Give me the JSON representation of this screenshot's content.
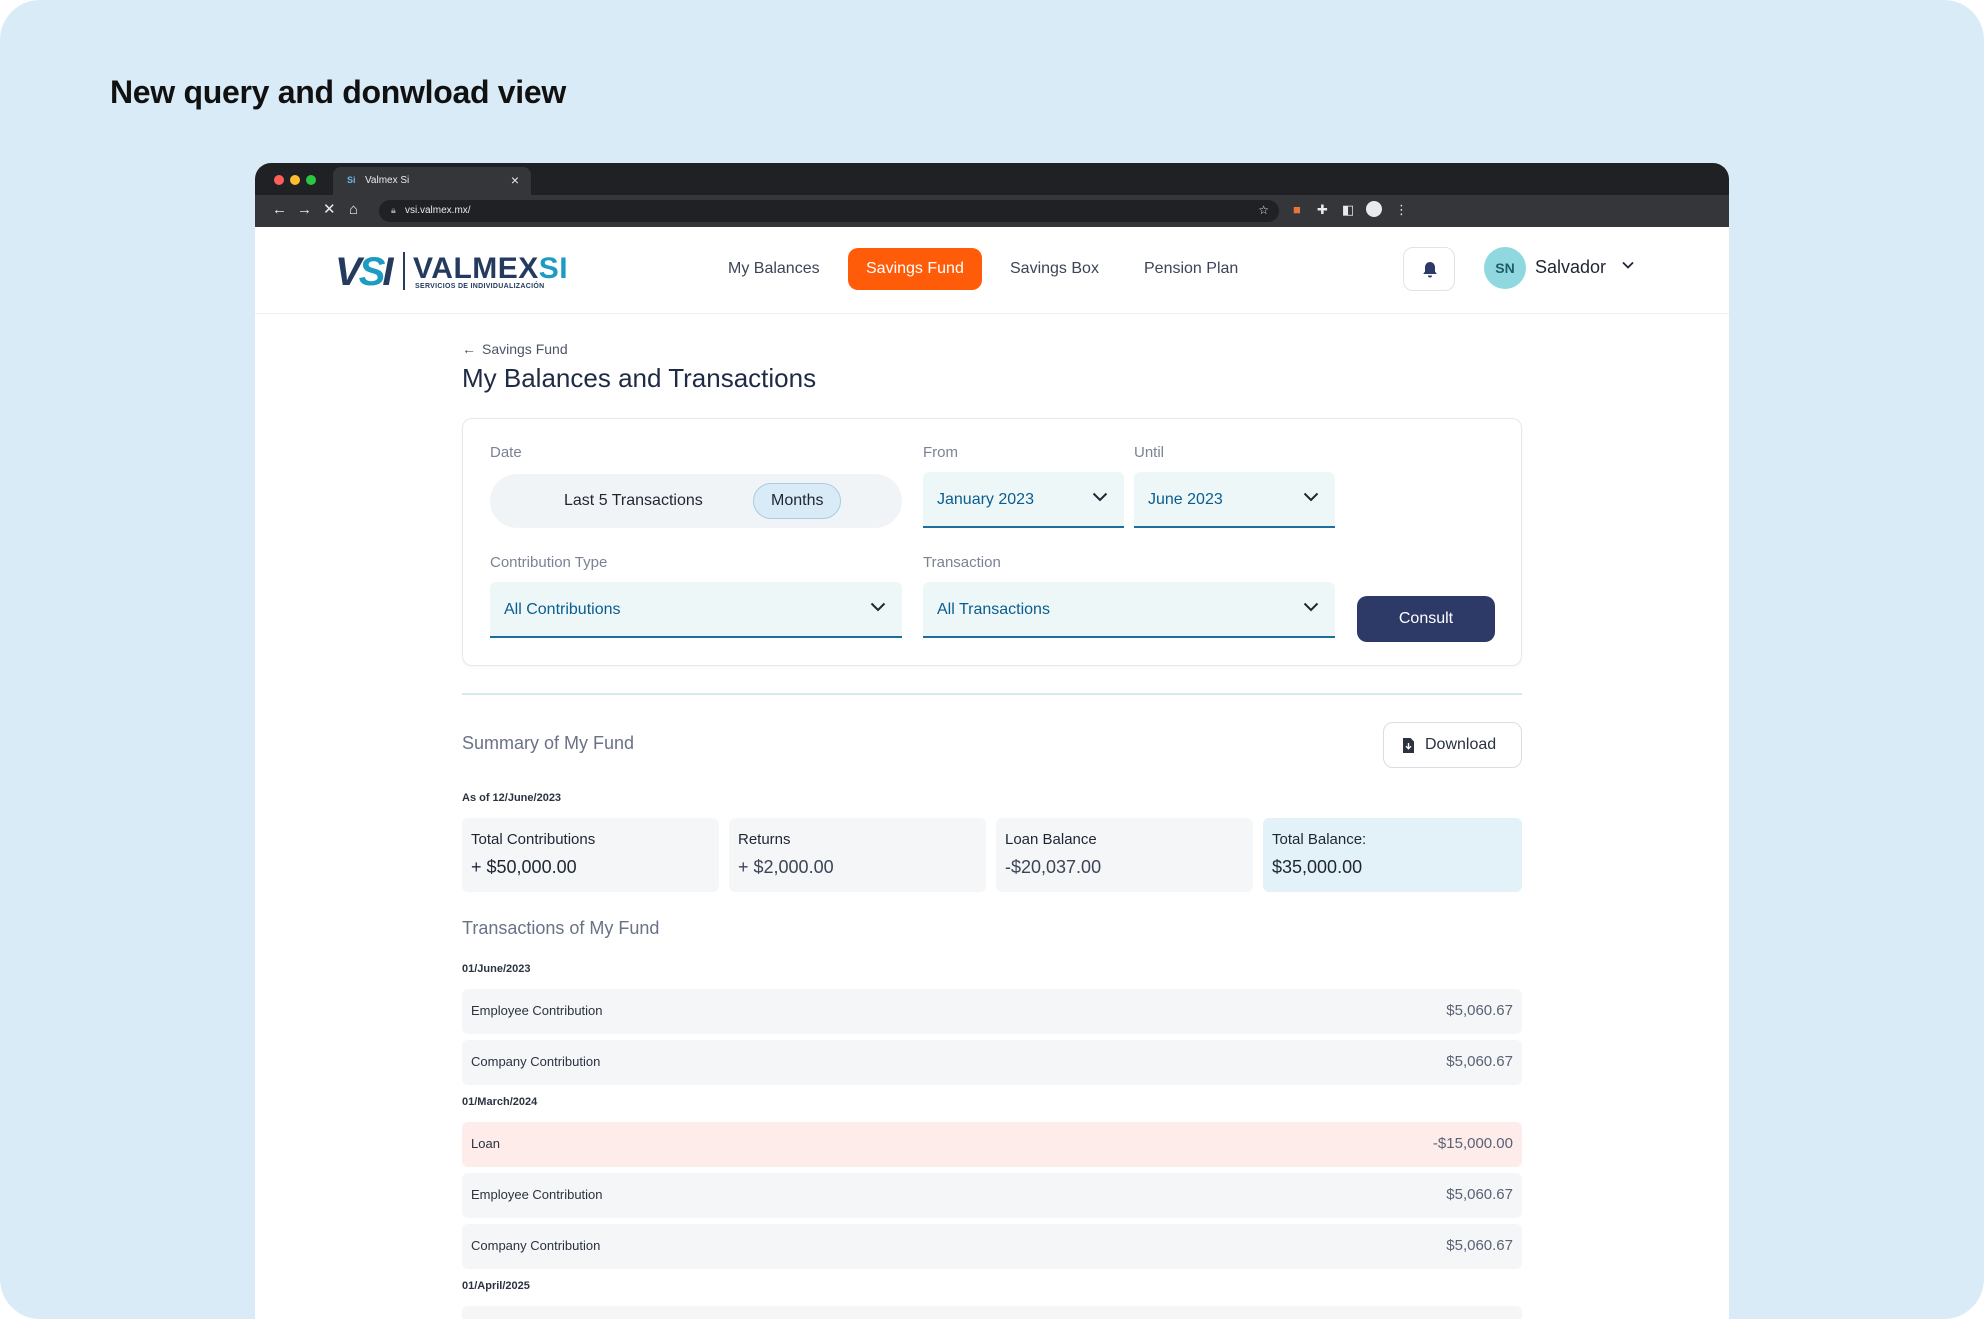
{
  "heading": "New query and donwload view",
  "browser": {
    "tab_title": "Valmex Si",
    "tab_icon": "Si",
    "url": "vsi.valmex.mx/"
  },
  "brand": {
    "mark": "VSI",
    "name_main": "VALMEX",
    "name_accent": "SI",
    "tagline": "SERVICIOS DE INDIVIDUALIZACIÓN",
    "primary_color": "#243a5e",
    "accent_color": "#1d9bc2"
  },
  "nav": {
    "items": [
      {
        "label": "My Balances",
        "active": false
      },
      {
        "label": "Savings Fund",
        "active": true
      },
      {
        "label": "Savings Box",
        "active": false
      },
      {
        "label": "Pension Plan",
        "active": false
      }
    ],
    "active_color": "#ff5c0a"
  },
  "user": {
    "initials": "SN",
    "name": "Salvador"
  },
  "page": {
    "back_label": "Savings Fund",
    "title": "My Balances and Transactions"
  },
  "filters": {
    "date_label": "Date",
    "date_options": [
      "Last 5 Transactions",
      "Months"
    ],
    "date_selected": "Months",
    "from_label": "From",
    "from_value": "January 2023",
    "until_label": "Until",
    "until_value": "June 2023",
    "contribution_label": "Contribution Type",
    "contribution_value": "All Contributions",
    "transaction_label": "Transaction",
    "transaction_value": "All Transactions",
    "consult_label": "Consult"
  },
  "summary": {
    "title": "Summary of My Fund",
    "download_label": "Download",
    "as_of": "As of 12/June/2023",
    "cards": [
      {
        "label": "Total Contributions",
        "value": "+ $50,000.00"
      },
      {
        "label": "Returns",
        "value": "+ $2,000.00"
      },
      {
        "label": "Loan Balance",
        "value": "-$20,037.00"
      },
      {
        "label": "Total Balance:",
        "value": "$35,000.00"
      }
    ]
  },
  "transactions": {
    "title": "Transactions of My Fund",
    "groups": [
      {
        "date": "01/June/2023",
        "rows": [
          {
            "name": "Employee Contribution",
            "amount": "$5,060.67"
          },
          {
            "name": "Company Contribution",
            "amount": "$5,060.67"
          }
        ]
      },
      {
        "date": "01/March/2024",
        "rows": [
          {
            "name": "Loan",
            "amount": "-$15,000.00"
          },
          {
            "name": "Employee Contribution",
            "amount": "$5,060.67"
          },
          {
            "name": "Company Contribution",
            "amount": "$5,060.67"
          }
        ]
      },
      {
        "date": "01/April/2025",
        "rows": []
      }
    ]
  }
}
